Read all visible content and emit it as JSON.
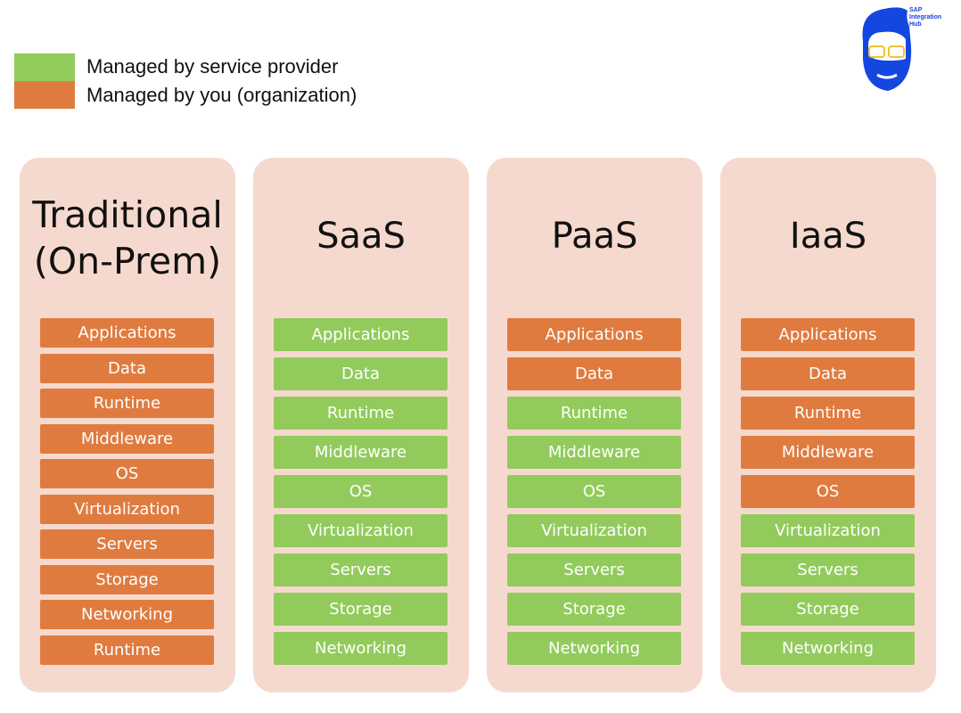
{
  "colors": {
    "provider": "#92CB5C",
    "you": "#E07B3F",
    "panel": "#F6D9CE",
    "brand": "#1446E0"
  },
  "legend": [
    {
      "label": "Managed by service provider",
      "color": "provider"
    },
    {
      "label": "Managed by you (organization)",
      "color": "you"
    }
  ],
  "logo": {
    "line1": "SAP",
    "line2": "Integration",
    "line3": "Hub"
  },
  "columns": [
    {
      "title_line1": "Traditional",
      "title_line2": "(On-Prem)",
      "items": [
        {
          "label": "Applications",
          "managed": "you"
        },
        {
          "label": "Data",
          "managed": "you"
        },
        {
          "label": "Runtime",
          "managed": "you"
        },
        {
          "label": "Middleware",
          "managed": "you"
        },
        {
          "label": "OS",
          "managed": "you"
        },
        {
          "label": "Virtualization",
          "managed": "you"
        },
        {
          "label": "Servers",
          "managed": "you"
        },
        {
          "label": "Storage",
          "managed": "you"
        },
        {
          "label": "Networking",
          "managed": "you"
        },
        {
          "label": "Runtime",
          "managed": "you"
        }
      ]
    },
    {
      "title_line1": "SaaS",
      "title_line2": "",
      "items": [
        {
          "label": "Applications",
          "managed": "provider"
        },
        {
          "label": "Data",
          "managed": "provider"
        },
        {
          "label": "Runtime",
          "managed": "provider"
        },
        {
          "label": "Middleware",
          "managed": "provider"
        },
        {
          "label": "OS",
          "managed": "provider"
        },
        {
          "label": "Virtualization",
          "managed": "provider"
        },
        {
          "label": "Servers",
          "managed": "provider"
        },
        {
          "label": "Storage",
          "managed": "provider"
        },
        {
          "label": "Networking",
          "managed": "provider"
        }
      ]
    },
    {
      "title_line1": "PaaS",
      "title_line2": "",
      "items": [
        {
          "label": "Applications",
          "managed": "you"
        },
        {
          "label": "Data",
          "managed": "you"
        },
        {
          "label": "Runtime",
          "managed": "provider"
        },
        {
          "label": "Middleware",
          "managed": "provider"
        },
        {
          "label": "OS",
          "managed": "provider"
        },
        {
          "label": "Virtualization",
          "managed": "provider"
        },
        {
          "label": "Servers",
          "managed": "provider"
        },
        {
          "label": "Storage",
          "managed": "provider"
        },
        {
          "label": "Networking",
          "managed": "provider"
        }
      ]
    },
    {
      "title_line1": "IaaS",
      "title_line2": "",
      "items": [
        {
          "label": "Applications",
          "managed": "you"
        },
        {
          "label": "Data",
          "managed": "you"
        },
        {
          "label": "Runtime",
          "managed": "you"
        },
        {
          "label": "Middleware",
          "managed": "you"
        },
        {
          "label": "OS",
          "managed": "you"
        },
        {
          "label": "Virtualization",
          "managed": "provider"
        },
        {
          "label": "Servers",
          "managed": "provider"
        },
        {
          "label": "Storage",
          "managed": "provider"
        },
        {
          "label": "Networking",
          "managed": "provider"
        }
      ]
    }
  ]
}
